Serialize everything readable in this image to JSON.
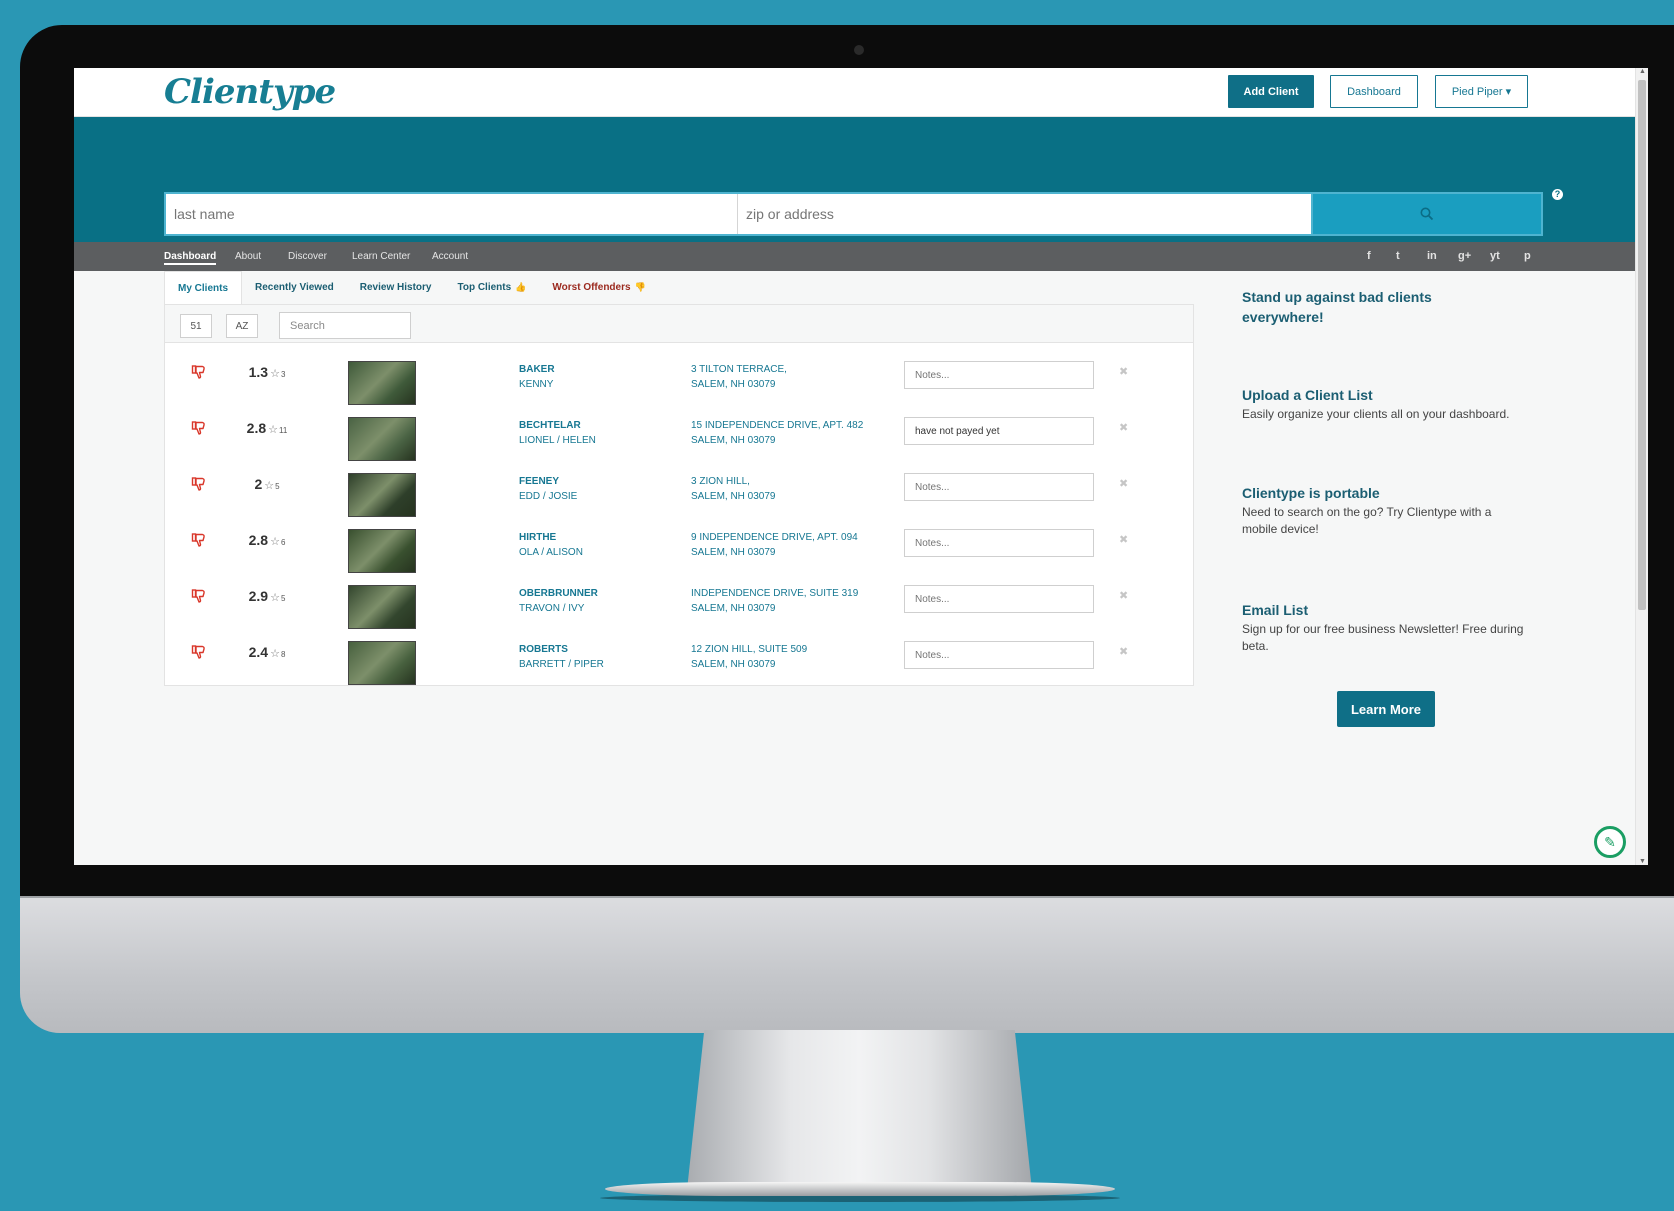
{
  "app": {
    "logo": "Clientype",
    "buttons": {
      "add_client": "Add Client",
      "dashboard": "Dashboard",
      "account_menu": "Pied Piper ▾"
    }
  },
  "search": {
    "last_name_placeholder": "last name",
    "zip_placeholder": "zip or address",
    "button_icon": "search-icon",
    "help_icon": "?"
  },
  "nav": {
    "items": [
      "Dashboard",
      "About",
      "Discover",
      "Learn Center",
      "Account"
    ],
    "social": [
      "f",
      "t",
      "in",
      "g+",
      "yt",
      "p"
    ]
  },
  "tabs": [
    {
      "label": "My Clients"
    },
    {
      "label": "Recently Viewed"
    },
    {
      "label": "Review History"
    },
    {
      "label": "Top Clients",
      "icon": "👍"
    },
    {
      "label": "Worst Offenders",
      "icon": "👎"
    }
  ],
  "toolbar": {
    "count": "51",
    "sort": "AZ",
    "search_placeholder": "Search"
  },
  "clients": [
    {
      "rating": "1.3",
      "reviews": "3",
      "last": "BAKER",
      "first": "KENNY",
      "addr1": "3 TILTON TERRACE,",
      "addr2": "SALEM, NH 03079",
      "notes": "",
      "photo_color": "#3f5a3a"
    },
    {
      "rating": "2.8",
      "reviews": "11",
      "last": "BECHTELAR",
      "first": "LIONEL / HELEN",
      "addr1": "15 INDEPENDENCE DRIVE, APT. 482",
      "addr2": "SALEM, NH 03079",
      "notes": "have not payed yet",
      "photo_color": "#4a6344"
    },
    {
      "rating": "2",
      "reviews": "5",
      "last": "FEENEY",
      "first": "EDD / JOSIE",
      "addr1": "3 ZION HILL,",
      "addr2": "SALEM, NH 03079",
      "notes": "",
      "photo_color": "#2e3f2a"
    },
    {
      "rating": "2.8",
      "reviews": "6",
      "last": "HIRTHE",
      "first": "OLA / ALISON",
      "addr1": "9 INDEPENDENCE DRIVE, APT. 094",
      "addr2": "SALEM, NH 03079",
      "notes": "",
      "photo_color": "#39502f"
    },
    {
      "rating": "2.9",
      "reviews": "5",
      "last": "OBERBRUNNER",
      "first": "TRAVON / IVY",
      "addr1": "INDEPENDENCE DRIVE, SUITE 319",
      "addr2": "SALEM, NH 03079",
      "notes": "",
      "photo_color": "#33462e"
    },
    {
      "rating": "2.4",
      "reviews": "8",
      "last": "ROBERTS",
      "first": "BARRETT / PIPER",
      "addr1": "12 ZION HILL, SUITE 509",
      "addr2": "SALEM, NH 03079",
      "notes": "",
      "photo_color": "#47603e"
    }
  ],
  "notes_placeholder": "Notes...",
  "sidebar": {
    "headline": "Stand up against bad clients everywhere!",
    "upload_title": "Upload a Client List",
    "upload_text": "Easily organize your clients all on your dashboard.",
    "portable_title": "Clientype is portable",
    "portable_text": "Need to search on the go? Try Clientype with a mobile device!",
    "email_title": "Email List",
    "email_text": "Sign up for our free business Newsletter! Free during beta.",
    "learn_more": "Learn More"
  },
  "colors": {
    "brand": "#167792",
    "hero": "#097085",
    "nav": "#5c5e60",
    "bad": "#d9372a",
    "fab": "#1a9e63"
  }
}
